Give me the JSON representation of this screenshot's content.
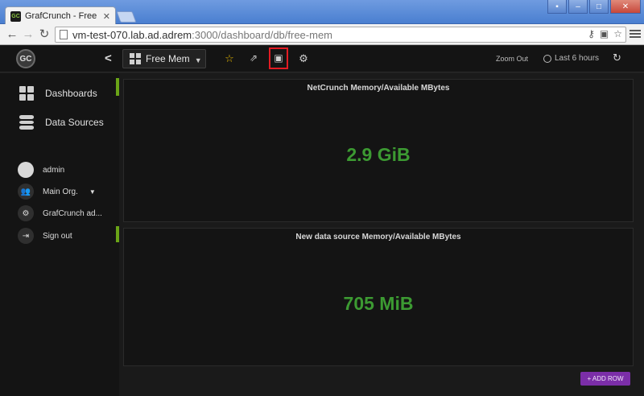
{
  "browser": {
    "tab_title": "GrafCrunch - Free Mem",
    "favicon_text": "GC",
    "url_host": "vm-test-070.lab.ad.adrem",
    "url_path": ":3000/dashboard/db/free-mem"
  },
  "navbar": {
    "logo_text": "GC",
    "dashboard_title": "Free Mem",
    "zoom_out_label": "Zoom Out",
    "time_range_label": "Last 6 hours"
  },
  "sidebar": {
    "dashboards_label": "Dashboards",
    "data_sources_label": "Data Sources",
    "user_label": "admin",
    "org_label": "Main Org.",
    "app_label": "GrafCrunch ad...",
    "signout_label": "Sign out"
  },
  "panels": [
    {
      "title": "NetCrunch Memory/Available MBytes",
      "value": "2.9 GiB"
    },
    {
      "title": "New data source Memory/Available MBytes",
      "value": "705 MiB"
    }
  ],
  "add_row_label": "+ ADD ROW",
  "colors": {
    "accent_green": "#3c9a32",
    "sidebar_accent": "#6aa417",
    "highlight_red": "#e31b23",
    "add_row_purple": "#7b2ea8"
  }
}
